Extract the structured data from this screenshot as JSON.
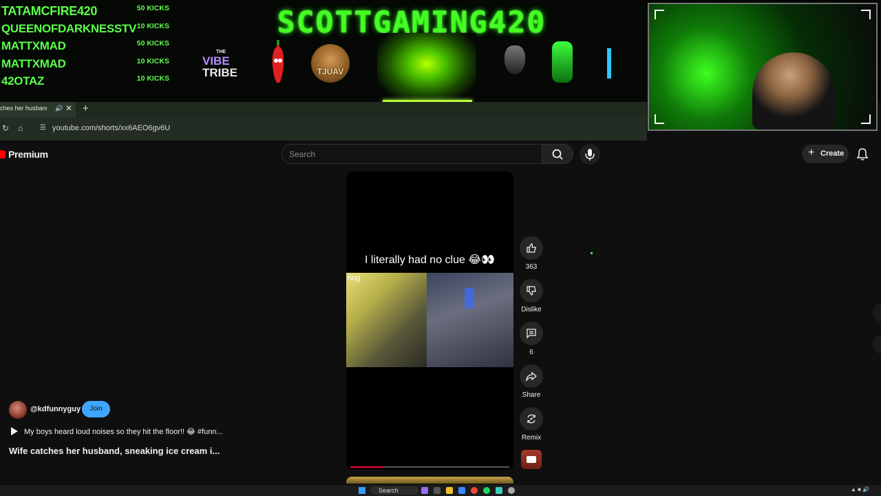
{
  "overlay": {
    "kicks": [
      {
        "name": "TATAMCFIRE420",
        "amount": "50 KICKS"
      },
      {
        "name": "QUEENOFDARKNESSTV",
        "amount": "10 KICKS"
      },
      {
        "name": "MATTXMAD",
        "amount": "50 KICKS"
      },
      {
        "name": "MATTXMAD",
        "amount": "10 KICKS"
      },
      {
        "name": "42OTAZ",
        "amount": "10 KICKS"
      }
    ],
    "title": "SCOTTGAMING420",
    "vibe_the": "THE",
    "vibe_vibe": "VIBE",
    "vibe_tribe": "TRIBE",
    "tjuav": "TJUAV",
    "accent": "#44ff22"
  },
  "browser": {
    "tab_title": "ches her husband,",
    "url": "youtube.com/shorts/xx6AEO6gv6U"
  },
  "youtube": {
    "logo": "Premium",
    "search_placeholder": "Search",
    "create_label": "Create",
    "short": {
      "caption": "I literally had no clue 😂👀",
      "watermark": "ring",
      "progress_fraction": 0.21
    },
    "actions": {
      "likes": "363",
      "dislike_label": "Dislike",
      "comments": "6",
      "share_label": "Share",
      "remix_label": "Remix"
    },
    "channel": {
      "handle": "@kdfunnyguy",
      "join_label": "Join"
    },
    "description": "My boys heard loud noises so they hit the floor!! 😂 #funn...",
    "title": "Wife catches her husband, sneaking ice cream i..."
  },
  "taskbar": {
    "search_label": "Search"
  }
}
